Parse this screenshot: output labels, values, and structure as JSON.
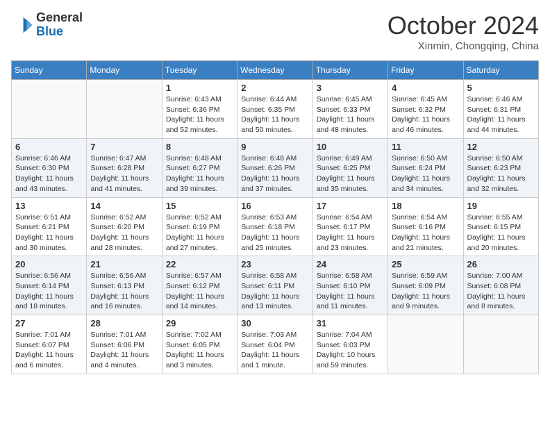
{
  "header": {
    "logo_line1": "General",
    "logo_line2": "Blue",
    "month_title": "October 2024",
    "subtitle": "Xinmin, Chongqing, China"
  },
  "days_of_week": [
    "Sunday",
    "Monday",
    "Tuesday",
    "Wednesday",
    "Thursday",
    "Friday",
    "Saturday"
  ],
  "weeks": [
    [
      {
        "day": "",
        "detail": ""
      },
      {
        "day": "",
        "detail": ""
      },
      {
        "day": "1",
        "detail": "Sunrise: 6:43 AM\nSunset: 6:36 PM\nDaylight: 11 hours and 52 minutes."
      },
      {
        "day": "2",
        "detail": "Sunrise: 6:44 AM\nSunset: 6:35 PM\nDaylight: 11 hours and 50 minutes."
      },
      {
        "day": "3",
        "detail": "Sunrise: 6:45 AM\nSunset: 6:33 PM\nDaylight: 11 hours and 48 minutes."
      },
      {
        "day": "4",
        "detail": "Sunrise: 6:45 AM\nSunset: 6:32 PM\nDaylight: 11 hours and 46 minutes."
      },
      {
        "day": "5",
        "detail": "Sunrise: 6:46 AM\nSunset: 6:31 PM\nDaylight: 11 hours and 44 minutes."
      }
    ],
    [
      {
        "day": "6",
        "detail": "Sunrise: 6:46 AM\nSunset: 6:30 PM\nDaylight: 11 hours and 43 minutes."
      },
      {
        "day": "7",
        "detail": "Sunrise: 6:47 AM\nSunset: 6:28 PM\nDaylight: 11 hours and 41 minutes."
      },
      {
        "day": "8",
        "detail": "Sunrise: 6:48 AM\nSunset: 6:27 PM\nDaylight: 11 hours and 39 minutes."
      },
      {
        "day": "9",
        "detail": "Sunrise: 6:48 AM\nSunset: 6:26 PM\nDaylight: 11 hours and 37 minutes."
      },
      {
        "day": "10",
        "detail": "Sunrise: 6:49 AM\nSunset: 6:25 PM\nDaylight: 11 hours and 35 minutes."
      },
      {
        "day": "11",
        "detail": "Sunrise: 6:50 AM\nSunset: 6:24 PM\nDaylight: 11 hours and 34 minutes."
      },
      {
        "day": "12",
        "detail": "Sunrise: 6:50 AM\nSunset: 6:23 PM\nDaylight: 11 hours and 32 minutes."
      }
    ],
    [
      {
        "day": "13",
        "detail": "Sunrise: 6:51 AM\nSunset: 6:21 PM\nDaylight: 11 hours and 30 minutes."
      },
      {
        "day": "14",
        "detail": "Sunrise: 6:52 AM\nSunset: 6:20 PM\nDaylight: 11 hours and 28 minutes."
      },
      {
        "day": "15",
        "detail": "Sunrise: 6:52 AM\nSunset: 6:19 PM\nDaylight: 11 hours and 27 minutes."
      },
      {
        "day": "16",
        "detail": "Sunrise: 6:53 AM\nSunset: 6:18 PM\nDaylight: 11 hours and 25 minutes."
      },
      {
        "day": "17",
        "detail": "Sunrise: 6:54 AM\nSunset: 6:17 PM\nDaylight: 11 hours and 23 minutes."
      },
      {
        "day": "18",
        "detail": "Sunrise: 6:54 AM\nSunset: 6:16 PM\nDaylight: 11 hours and 21 minutes."
      },
      {
        "day": "19",
        "detail": "Sunrise: 6:55 AM\nSunset: 6:15 PM\nDaylight: 11 hours and 20 minutes."
      }
    ],
    [
      {
        "day": "20",
        "detail": "Sunrise: 6:56 AM\nSunset: 6:14 PM\nDaylight: 11 hours and 18 minutes."
      },
      {
        "day": "21",
        "detail": "Sunrise: 6:56 AM\nSunset: 6:13 PM\nDaylight: 11 hours and 16 minutes."
      },
      {
        "day": "22",
        "detail": "Sunrise: 6:57 AM\nSunset: 6:12 PM\nDaylight: 11 hours and 14 minutes."
      },
      {
        "day": "23",
        "detail": "Sunrise: 6:58 AM\nSunset: 6:11 PM\nDaylight: 11 hours and 13 minutes."
      },
      {
        "day": "24",
        "detail": "Sunrise: 6:58 AM\nSunset: 6:10 PM\nDaylight: 11 hours and 11 minutes."
      },
      {
        "day": "25",
        "detail": "Sunrise: 6:59 AM\nSunset: 6:09 PM\nDaylight: 11 hours and 9 minutes."
      },
      {
        "day": "26",
        "detail": "Sunrise: 7:00 AM\nSunset: 6:08 PM\nDaylight: 11 hours and 8 minutes."
      }
    ],
    [
      {
        "day": "27",
        "detail": "Sunrise: 7:01 AM\nSunset: 6:07 PM\nDaylight: 11 hours and 6 minutes."
      },
      {
        "day": "28",
        "detail": "Sunrise: 7:01 AM\nSunset: 6:06 PM\nDaylight: 11 hours and 4 minutes."
      },
      {
        "day": "29",
        "detail": "Sunrise: 7:02 AM\nSunset: 6:05 PM\nDaylight: 11 hours and 3 minutes."
      },
      {
        "day": "30",
        "detail": "Sunrise: 7:03 AM\nSunset: 6:04 PM\nDaylight: 11 hours and 1 minute."
      },
      {
        "day": "31",
        "detail": "Sunrise: 7:04 AM\nSunset: 6:03 PM\nDaylight: 10 hours and 59 minutes."
      },
      {
        "day": "",
        "detail": ""
      },
      {
        "day": "",
        "detail": ""
      }
    ]
  ]
}
